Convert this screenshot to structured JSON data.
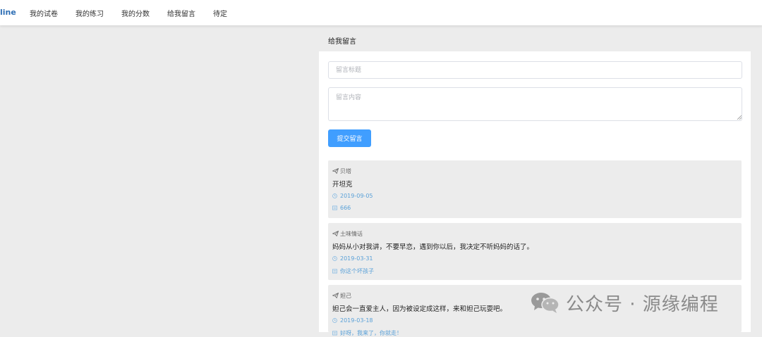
{
  "nav": {
    "brand": "line",
    "items": [
      {
        "label": "我的试卷"
      },
      {
        "label": "我的练习"
      },
      {
        "label": "我的分数"
      },
      {
        "label": "给我留言"
      },
      {
        "label": "待定"
      }
    ]
  },
  "page": {
    "section_title": "给我留言"
  },
  "form": {
    "title_placeholder": "留言标题",
    "title_value": "",
    "content_placeholder": "留言内容",
    "content_value": "",
    "submit_label": "提交留言"
  },
  "messages": [
    {
      "author": "贝塔",
      "title": "开坦克",
      "date": "2019-09-05",
      "reply": "666",
      "author_icon": "paper-plane-icon",
      "date_icon": "clock-icon",
      "reply_icon": "message-icon"
    },
    {
      "author": "土味情话",
      "title": "妈妈从小对我讲，不要早恋，遇到你以后，我决定不听妈妈的话了。",
      "date": "2019-03-31",
      "reply": "你这个坏孩子",
      "author_icon": "paper-plane-icon",
      "date_icon": "clock-icon",
      "reply_icon": "message-icon"
    },
    {
      "author": "妲己",
      "title": "妲己会一直爱主人，因为被设定成这样，来和妲己玩耍吧。",
      "date": "2019-03-18",
      "reply": "好呀，我来了，你就走！",
      "author_icon": "paper-plane-icon",
      "date_icon": "clock-icon",
      "reply_icon": "message-icon"
    }
  ],
  "watermark": {
    "text": "公众号 · 源缘编程",
    "icon": "wechat-icon"
  },
  "colors": {
    "brand": "#2f6fb5",
    "primary": "#409eff",
    "meta_blue": "#5aa1d8",
    "page_bg": "#ececec",
    "card_bg": "#ececec"
  }
}
